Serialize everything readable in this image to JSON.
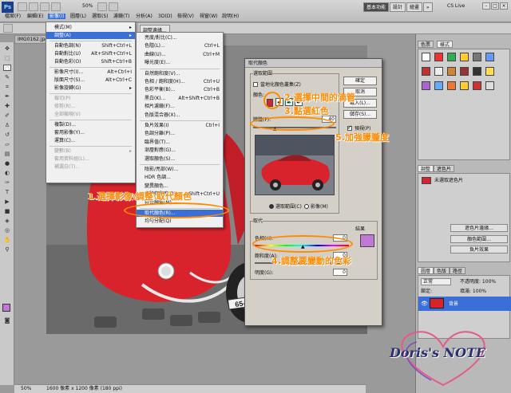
{
  "app": {
    "logo": "Ps",
    "zoom": "50%",
    "workspace_buttons": [
      "基本功能",
      "設計",
      "繪畫",
      "»"
    ],
    "cs_live": "CS Live",
    "window_controls": [
      "-",
      "□",
      "×"
    ]
  },
  "menubar": [
    "檔案(F)",
    "編輯(E)",
    "影像(I)",
    "圖層(L)",
    "選取(S)",
    "濾鏡(T)",
    "分析(A)",
    "3D(D)",
    "檢視(V)",
    "視窗(W)",
    "說明(H)"
  ],
  "options": {
    "refine": "調整邊緣..."
  },
  "document": {
    "tab": "IMG0162.jpg",
    "status_zoom": "50%",
    "status_info": "1600 像素 x 1200 像素 (180 ppi)",
    "plate": "65-0"
  },
  "image_menu": {
    "items": [
      {
        "label": "模式(M)",
        "sc": "▸"
      },
      {
        "label": "調整(A)",
        "sc": "▸",
        "sel": true
      },
      {
        "label": "自動色調(N)",
        "sc": "Shift+Ctrl+L"
      },
      {
        "label": "自動對比(U)",
        "sc": "Alt+Shift+Ctrl+L"
      },
      {
        "label": "自動色彩(O)",
        "sc": "Shift+Ctrl+B"
      },
      {
        "label": "影像尺寸(I)...",
        "sc": "Alt+Ctrl+I"
      },
      {
        "label": "版面尺寸(S)...",
        "sc": "Alt+Ctrl+C"
      },
      {
        "label": "影像旋轉(G)",
        "sc": "▸"
      },
      {
        "label": "裁切(P)",
        "dis": true
      },
      {
        "label": "修剪(R)...",
        "dis": true
      },
      {
        "label": "全部顯現(V)",
        "dis": true
      },
      {
        "label": "複製(D)..."
      },
      {
        "label": "套用影像(Y)..."
      },
      {
        "label": "運算(C)..."
      },
      {
        "label": "變數(B)",
        "sc": "▸",
        "dis": true
      },
      {
        "label": "套用資料組(L)...",
        "dis": true
      },
      {
        "label": "補漏白(T)...",
        "dis": true
      }
    ]
  },
  "adjust_menu": {
    "items": [
      {
        "label": "亮度/對比(C)..."
      },
      {
        "label": "色階(L)...",
        "sc": "Ctrl+L"
      },
      {
        "label": "曲線(U)...",
        "sc": "Ctrl+M"
      },
      {
        "label": "曝光度(E)..."
      },
      {
        "label": "自然飽和度(V)..."
      },
      {
        "label": "色相 / 飽和度(H)...",
        "sc": "Ctrl+U"
      },
      {
        "label": "色彩平衡(B)...",
        "sc": "Ctrl+B"
      },
      {
        "label": "黑白(K)...",
        "sc": "Alt+Shift+Ctrl+B"
      },
      {
        "label": "相片濾鏡(F)..."
      },
      {
        "label": "色版混合器(X)..."
      },
      {
        "label": "負片效果(I)",
        "sc": "Ctrl+I"
      },
      {
        "label": "色調分離(P)..."
      },
      {
        "label": "臨界值(T)..."
      },
      {
        "label": "漸層對應(G)..."
      },
      {
        "label": "選取顏色(S)..."
      },
      {
        "label": "陰影/亮部(W)..."
      },
      {
        "label": "HDR 色調..."
      },
      {
        "label": "變異顏色..."
      },
      {
        "label": "去除飽和度(D)",
        "sc": "Shift+Ctrl+U"
      },
      {
        "label": "符合顏色(M)..."
      },
      {
        "label": "取代顏色(R)...",
        "sel": true
      },
      {
        "label": "均勻分配(Q)"
      }
    ]
  },
  "dialog": {
    "title": "取代顏色",
    "selection_group": "選取範圍",
    "localized_clusters": "當地化顏色叢集(Z)",
    "color_label": "顏色:",
    "fuzziness_label": "朦朧(F):",
    "fuzziness_value": "40",
    "radio_selection": "選取範圍(C)",
    "radio_image": "影像(M)",
    "replacement_group": "取代",
    "hue_label": "色相(H):",
    "hue_value": "0",
    "saturation_label": "飽和度(A):",
    "saturation_value": "0",
    "lightness_label": "明度(G):",
    "lightness_value": "0",
    "result_label": "結果",
    "preview_label": "預視(P)",
    "buttons": {
      "ok": "確定",
      "cancel": "取消",
      "load": "載入(L)...",
      "save": "儲存(S)..."
    }
  },
  "panels": {
    "color_tabs": [
      "色票",
      "樣式"
    ],
    "adjust_tabs": [
      "調整",
      "遮色片"
    ],
    "adjust_title": "未選取遮色片",
    "mask_buttons": [
      "遮色片邊緣...",
      "顏色範圍...",
      "負片效果"
    ],
    "layer_tabs": [
      "圖層",
      "色版",
      "路徑"
    ],
    "blend_mode": "正常",
    "opacity": "不透明度: 100%",
    "fill": "填滿: 100%",
    "lock": "鎖定:",
    "layer_name": "背景"
  },
  "annotations": {
    "step1": "1.選擇影像\\調整\\取代顏色",
    "step2": "2.選擇中間的滴管",
    "step3": "3.點選紅色",
    "step4": "4.調整要變動的色彩",
    "step5": "5.加強朦朧度"
  },
  "watermark": "Doris's NOTE",
  "colors": {
    "accent": "#ff8a00",
    "selection": "#3a6fd8",
    "car_red": "#d8232c",
    "foreground": "#c07ad6"
  }
}
